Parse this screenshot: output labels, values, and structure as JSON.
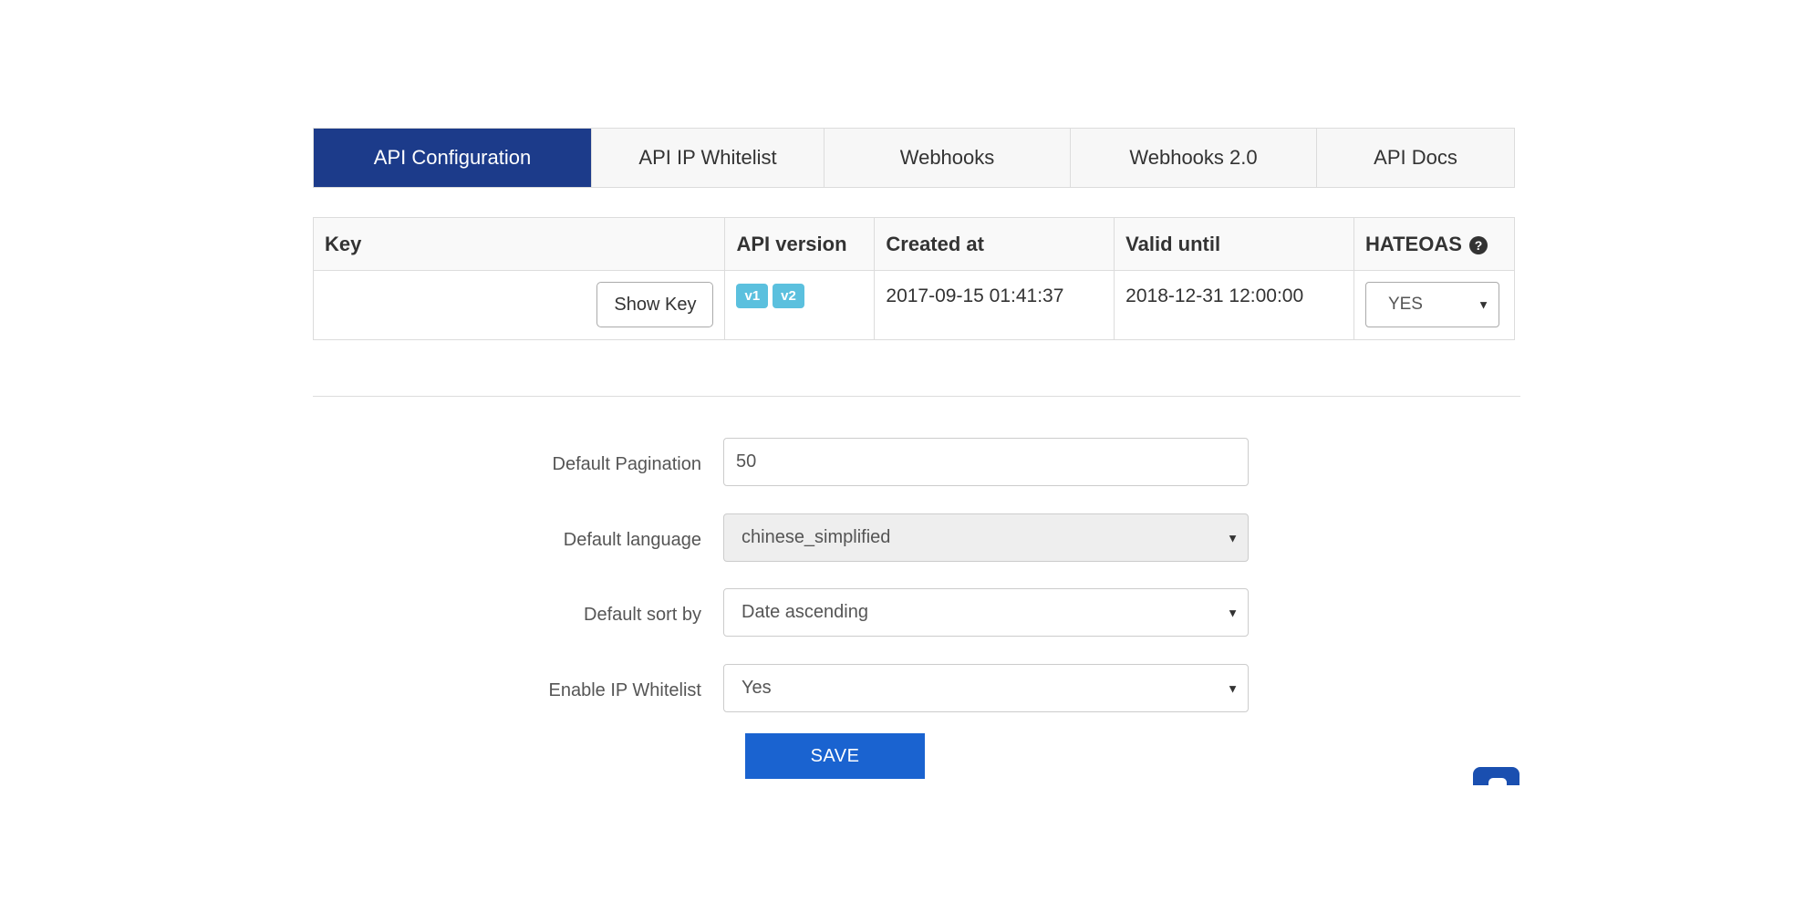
{
  "tabs": [
    {
      "label": "API Configuration",
      "active": true
    },
    {
      "label": "API IP Whitelist",
      "active": false
    },
    {
      "label": "Webhooks",
      "active": false
    },
    {
      "label": "Webhooks 2.0",
      "active": false
    },
    {
      "label": "API Docs",
      "active": false
    }
  ],
  "table": {
    "headers": {
      "key": "Key",
      "api_version": "API version",
      "created_at": "Created at",
      "valid_until": "Valid until",
      "hateoas": "HATEOAS"
    },
    "row": {
      "show_key_label": "Show Key",
      "versions": [
        "v1",
        "v2"
      ],
      "created_at": "2017-09-15 01:41:37",
      "valid_until": "2018-12-31 12:00:00",
      "hateoas_value": "YES"
    }
  },
  "form": {
    "pagination": {
      "label": "Default Pagination",
      "value": "50"
    },
    "language": {
      "label": "Default language",
      "value": "chinese_simplified"
    },
    "sort_by": {
      "label": "Default sort by",
      "value": "Date ascending"
    },
    "ip_whitelist": {
      "label": "Enable IP Whitelist",
      "value": "Yes"
    },
    "save_label": "SAVE"
  },
  "colors": {
    "active_tab": "#1c3b8a",
    "save_button": "#1a63d0",
    "badge": "#5bc0de",
    "chat_widget": "#1a4fb0"
  },
  "icons": {
    "help": "question-circle-icon",
    "caret": "caret-down-icon",
    "chat": "chat-bubble-icon"
  }
}
